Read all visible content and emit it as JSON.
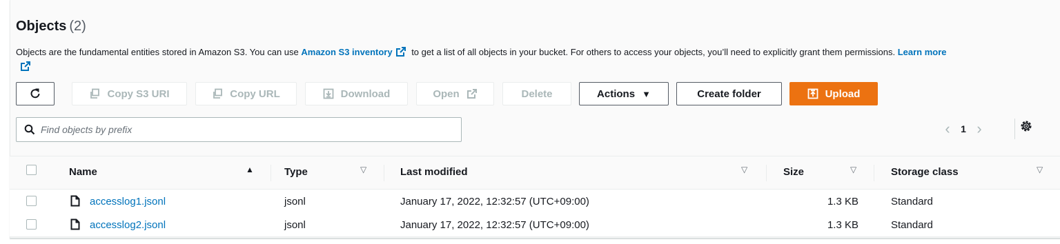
{
  "header": {
    "title": "Objects",
    "count": "(2)"
  },
  "description": {
    "part1": "Objects are the fundamental entities stored in Amazon S3. You can use ",
    "inventory_link": "Amazon S3 inventory",
    "part2": " to get a list of all objects in your bucket. For others to access your objects, you’ll need to explicitly grant them permissions. ",
    "learn_more": "Learn more"
  },
  "toolbar": {
    "copy_s3_uri": "Copy S3 URI",
    "copy_url": "Copy URL",
    "download": "Download",
    "open": "Open",
    "delete": "Delete",
    "actions": "Actions",
    "create_folder": "Create folder",
    "upload": "Upload"
  },
  "search": {
    "placeholder": "Find objects by prefix"
  },
  "pagination": {
    "current_page": "1"
  },
  "table": {
    "columns": {
      "name": "Name",
      "type": "Type",
      "last_modified": "Last modified",
      "size": "Size",
      "storage_class": "Storage class"
    },
    "rows": [
      {
        "name": "accesslog1.jsonl",
        "type": "jsonl",
        "last_modified": "January 17, 2022, 12:32:57 (UTC+09:00)",
        "size": "1.3 KB",
        "storage_class": "Standard"
      },
      {
        "name": "accesslog2.jsonl",
        "type": "jsonl",
        "last_modified": "January 17, 2022, 12:32:57 (UTC+09:00)",
        "size": "1.3 KB",
        "storage_class": "Standard"
      }
    ]
  },
  "icons": {
    "refresh": "refresh-icon",
    "copy": "copy-icon",
    "download": "download-icon",
    "external": "external-link-icon",
    "caret": "caret-down-icon",
    "upload": "upload-icon",
    "search": "search-icon",
    "settings": "gear-icon",
    "file": "file-icon"
  },
  "colors": {
    "link": "#0073bb",
    "primary": "#ec7211",
    "disabled": "#aab7b8"
  }
}
